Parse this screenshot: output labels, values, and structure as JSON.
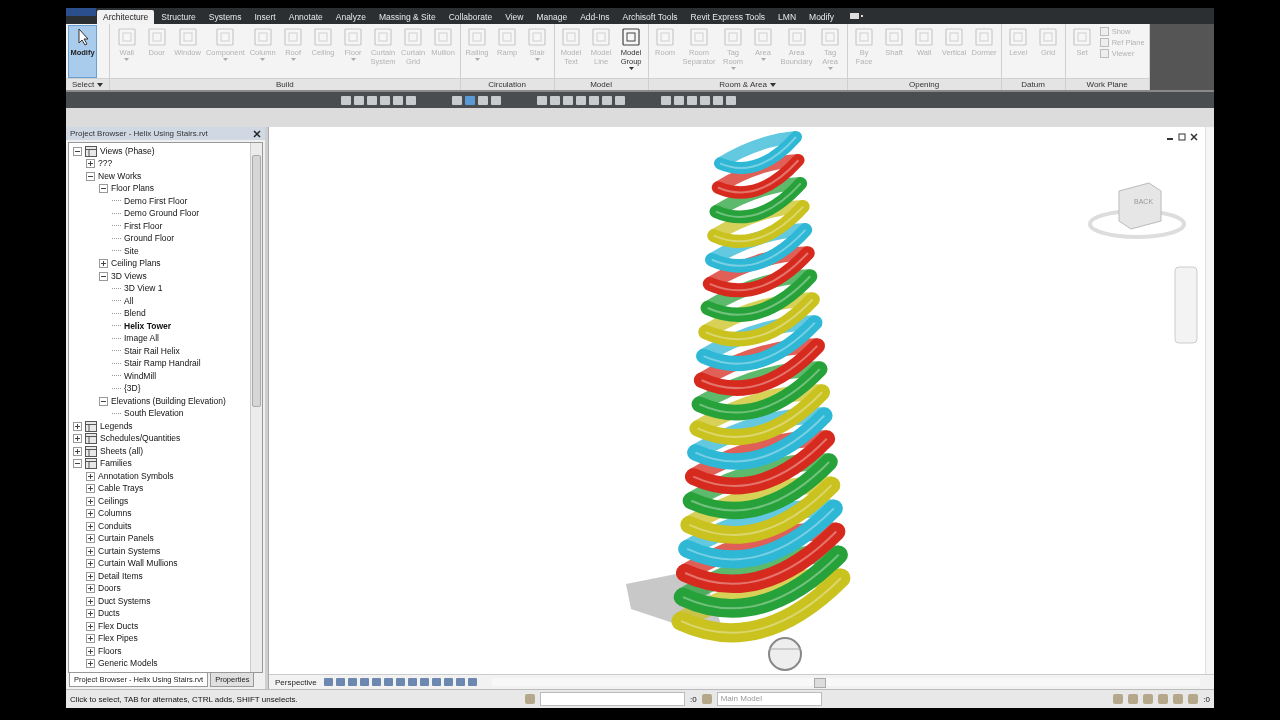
{
  "tabs": [
    {
      "label": "Architecture",
      "selected": true
    },
    {
      "label": "Structure",
      "selected": false
    },
    {
      "label": "Systems",
      "selected": false
    },
    {
      "label": "Insert",
      "selected": false
    },
    {
      "label": "Annotate",
      "selected": false
    },
    {
      "label": "Analyze",
      "selected": false
    },
    {
      "label": "Massing & Site",
      "selected": false
    },
    {
      "label": "Collaborate",
      "selected": false
    },
    {
      "label": "View",
      "selected": false
    },
    {
      "label": "Manage",
      "selected": false
    },
    {
      "label": "Add-Ins",
      "selected": false
    },
    {
      "label": "Archisoft Tools",
      "selected": false
    },
    {
      "label": "Revit Express Tools",
      "selected": false
    },
    {
      "label": "LMN",
      "selected": false
    },
    {
      "label": "Modify",
      "selected": false
    }
  ],
  "ribbon": {
    "groups": [
      {
        "label": "Select",
        "has_menu": true,
        "buttons": [
          {
            "label": "Modify",
            "active": true
          }
        ]
      },
      {
        "label": "Build",
        "buttons": [
          {
            "label": "Wall",
            "disabled": true,
            "has_menu": true
          },
          {
            "label": "Door",
            "disabled": true
          },
          {
            "label": "Window",
            "disabled": true
          },
          {
            "label": "Component",
            "disabled": true,
            "has_menu": true
          },
          {
            "label": "Column",
            "disabled": true,
            "has_menu": true
          },
          {
            "label": "Roof",
            "disabled": true,
            "has_menu": true
          },
          {
            "label": "Ceiling",
            "disabled": true
          },
          {
            "label": "Floor",
            "disabled": true,
            "has_menu": true
          },
          {
            "label": "Curtain\nSystem",
            "disabled": true
          },
          {
            "label": "Curtain\nGrid",
            "disabled": true
          },
          {
            "label": "Mullion",
            "disabled": true
          }
        ]
      },
      {
        "label": "Circulation",
        "buttons": [
          {
            "label": "Railing",
            "disabled": true,
            "has_menu": true
          },
          {
            "label": "Ramp",
            "disabled": true
          },
          {
            "label": "Stair",
            "disabled": true,
            "has_menu": true
          }
        ]
      },
      {
        "label": "Model",
        "buttons": [
          {
            "label": "Model\nText",
            "disabled": true
          },
          {
            "label": "Model\nLine",
            "disabled": true
          },
          {
            "label": "Model\nGroup",
            "disabled": false,
            "has_menu": true
          }
        ]
      },
      {
        "label": "Room & Area",
        "has_menu": true,
        "buttons": [
          {
            "label": "Room",
            "disabled": true
          },
          {
            "label": "Room\nSeparator",
            "disabled": true
          },
          {
            "label": "Tag\nRoom",
            "disabled": true,
            "has_menu": true
          },
          {
            "label": "Area",
            "disabled": true,
            "has_menu": true
          },
          {
            "label": "Area\nBoundary",
            "disabled": true
          },
          {
            "label": "Tag\nArea",
            "disabled": true,
            "has_menu": true
          }
        ]
      },
      {
        "label": "Opening",
        "buttons": [
          {
            "label": "By\nFace",
            "disabled": true
          },
          {
            "label": "Shaft",
            "disabled": true
          },
          {
            "label": "Wall",
            "disabled": true
          },
          {
            "label": "Vertical",
            "disabled": true
          },
          {
            "label": "Dormer",
            "disabled": true
          }
        ]
      },
      {
        "label": "Datum",
        "buttons": [
          {
            "label": "Level",
            "disabled": true
          },
          {
            "label": "Grid",
            "disabled": true
          }
        ]
      },
      {
        "label": "Work Plane",
        "buttons": [
          {
            "label": "Set",
            "disabled": true
          }
        ],
        "small_buttons": [
          {
            "label": "Show",
            "disabled": true
          },
          {
            "label": "Ref Plane",
            "disabled": true
          },
          {
            "label": "Viewer",
            "disabled": true
          }
        ]
      }
    ]
  },
  "browser": {
    "title": "Project Browser - Helix Using Stairs.rvt",
    "tree": [
      {
        "label": "Views (Phase)",
        "expanded": true,
        "children": [
          {
            "label": "???",
            "expanded": false
          },
          {
            "label": "New Works",
            "expanded": true,
            "children": [
              {
                "label": "Floor Plans",
                "expanded": true,
                "children": [
                  {
                    "label": "Demo First Floor"
                  },
                  {
                    "label": "Demo Ground Floor"
                  },
                  {
                    "label": "First Floor"
                  },
                  {
                    "label": "Ground Floor"
                  },
                  {
                    "label": "Site"
                  }
                ]
              },
              {
                "label": "Ceiling Plans",
                "expanded": false
              },
              {
                "label": "3D Views",
                "expanded": true,
                "children": [
                  {
                    "label": "3D View 1",
                    "current": false
                  },
                  {
                    "label": "All",
                    "current": false
                  },
                  {
                    "label": "Blend",
                    "current": false
                  },
                  {
                    "label": "Helix Tower",
                    "current": true
                  },
                  {
                    "label": "Image All",
                    "current": false
                  },
                  {
                    "label": "Stair Rail Helix",
                    "current": false
                  },
                  {
                    "label": "Stair Ramp Handrail",
                    "current": false
                  },
                  {
                    "label": "WindMill",
                    "current": false
                  },
                  {
                    "label": "{3D}",
                    "current": false
                  }
                ]
              },
              {
                "label": "Elevations (Building Elevation)",
                "expanded": true,
                "children": [
                  {
                    "label": "South Elevation"
                  }
                ]
              }
            ]
          }
        ]
      },
      {
        "label": "Legends",
        "expanded": false
      },
      {
        "label": "Schedules/Quantities",
        "expanded": false
      },
      {
        "label": "Sheets (all)",
        "expanded": false
      },
      {
        "label": "Families",
        "expanded": true,
        "children": [
          {
            "label": "Annotation Symbols",
            "expanded": false
          },
          {
            "label": "Cable Trays",
            "expanded": false
          },
          {
            "label": "Ceilings",
            "expanded": false
          },
          {
            "label": "Columns",
            "expanded": false
          },
          {
            "label": "Conduits",
            "expanded": false
          },
          {
            "label": "Curtain Panels",
            "expanded": false
          },
          {
            "label": "Curtain Systems",
            "expanded": false
          },
          {
            "label": "Curtain Wall Mullions",
            "expanded": false
          },
          {
            "label": "Detail Items",
            "expanded": false
          },
          {
            "label": "Doors",
            "expanded": false
          },
          {
            "label": "Duct Systems",
            "expanded": false
          },
          {
            "label": "Ducts",
            "expanded": false
          },
          {
            "label": "Flex Ducts",
            "expanded": false
          },
          {
            "label": "Flex Pipes",
            "expanded": false
          },
          {
            "label": "Floors",
            "expanded": false
          },
          {
            "label": "Generic Models",
            "expanded": false
          }
        ]
      }
    ],
    "bottom_tabs": [
      {
        "label": "Project Browser - Helix Using Stairs.rvt",
        "selected": true
      },
      {
        "label": "Properties",
        "selected": false
      }
    ]
  },
  "view": {
    "cube_label": "BACK",
    "view_control_label": "Perspective"
  },
  "status_bar": {
    "hint": "Click to select, TAB for alternates, CTRL adds, SHIFT unselects.",
    "workset_count": ":0",
    "design_option": "Main Model",
    "selection_count": ":0"
  }
}
